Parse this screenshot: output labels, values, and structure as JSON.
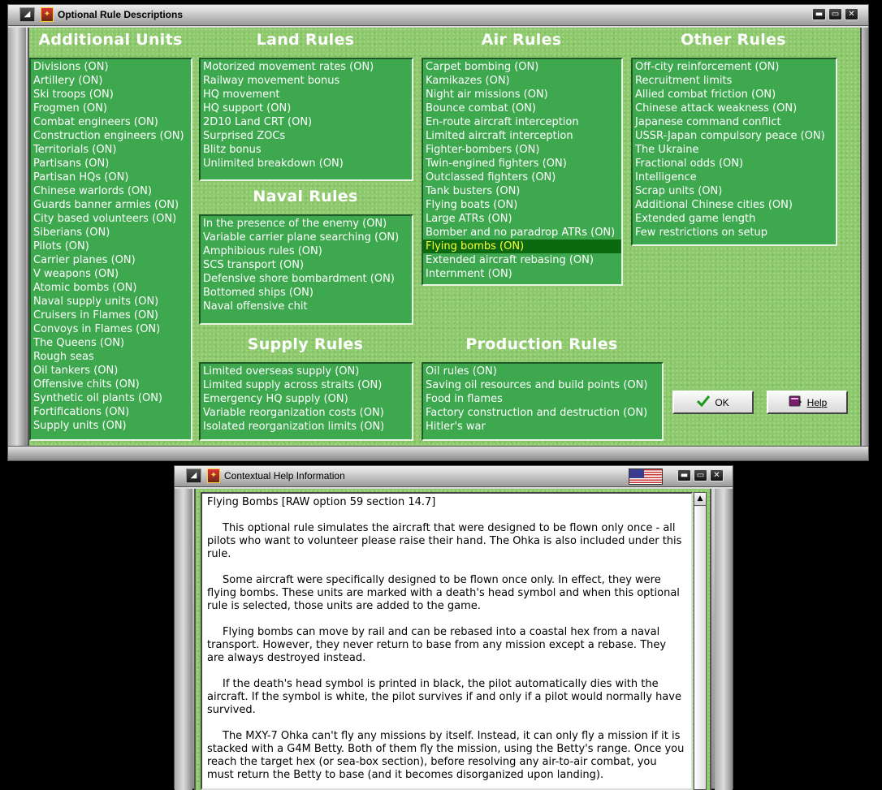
{
  "main_window": {
    "title": "Optional Rule Descriptions",
    "sections": {
      "additional_units": {
        "heading": "Additional Units",
        "items": [
          "Divisions (ON)",
          "Artillery (ON)",
          "Ski troops (ON)",
          "Frogmen (ON)",
          "Combat engineers (ON)",
          "Construction engineers (ON)",
          "Territorials (ON)",
          "Partisans (ON)",
          "Partisan HQs (ON)",
          "Chinese warlords (ON)",
          "Guards banner armies (ON)",
          "City based volunteers (ON)",
          "Siberians (ON)",
          "Pilots (ON)",
          "Carrier planes (ON)",
          "V weapons (ON)",
          "Atomic bombs (ON)",
          "Naval supply units (ON)",
          "Cruisers in Flames (ON)",
          "Convoys in Flames (ON)",
          "The Queens (ON)",
          "Rough seas",
          "Oil tankers (ON)",
          "Offensive chits (ON)",
          "Synthetic oil plants (ON)",
          "Fortifications (ON)",
          "Supply units (ON)"
        ]
      },
      "land_rules": {
        "heading": "Land Rules",
        "items": [
          "Motorized movement rates (ON)",
          "Railway movement bonus",
          "HQ movement",
          "HQ support (ON)",
          "2D10 Land CRT (ON)",
          "Surprised ZOCs",
          "Blitz bonus",
          "Unlimited breakdown (ON)"
        ]
      },
      "naval_rules": {
        "heading": "Naval Rules",
        "items": [
          "In the presence of the enemy (ON)",
          "Variable carrier plane searching (ON)",
          "Amphibious rules (ON)",
          "SCS transport (ON)",
          "Defensive shore bombardment (ON)",
          "Bottomed ships (ON)",
          "Naval offensive chit"
        ]
      },
      "air_rules": {
        "heading": "Air Rules",
        "selected_index": 13,
        "items": [
          "Carpet bombing (ON)",
          "Kamikazes (ON)",
          "Night air missions (ON)",
          "Bounce combat (ON)",
          "En-route aircraft interception",
          "Limited aircraft interception",
          "Fighter-bombers (ON)",
          "Twin-engined fighters (ON)",
          "Outclassed fighters (ON)",
          "Tank busters (ON)",
          "Flying boats (ON)",
          "Large ATRs (ON)",
          "Bomber and no paradrop ATRs (ON)",
          "Flying bombs (ON)",
          "Extended aircraft rebasing (ON)",
          "Internment (ON)"
        ]
      },
      "other_rules": {
        "heading": "Other Rules",
        "items": [
          "Off-city reinforcement (ON)",
          "Recruitment limits",
          "Allied combat friction (ON)",
          "Chinese attack weakness (ON)",
          "Japanese command conflict",
          "USSR-Japan compulsory peace (ON)",
          "The Ukraine",
          "Fractional odds (ON)",
          "Intelligence",
          "Scrap units (ON)",
          "Additional Chinese cities (ON)",
          "Extended game length",
          "Few restrictions on setup"
        ]
      },
      "supply_rules": {
        "heading": "Supply Rules",
        "items": [
          "Limited overseas supply (ON)",
          "Limited supply across straits (ON)",
          "Emergency HQ supply (ON)",
          "Variable reorganization costs (ON)",
          "Isolated reorganization limits (ON)"
        ]
      },
      "production_rules": {
        "heading": "Production Rules",
        "items": [
          "Oil rules (ON)",
          "Saving oil resources and build points (ON)",
          "Food in flames",
          "Factory construction and destruction (ON)",
          "Hitler's war"
        ]
      }
    },
    "buttons": {
      "ok": {
        "label": "OK",
        "icon": "checkmark-icon",
        "icon_color": "#1a9a1a"
      },
      "help": {
        "label": "Help",
        "icon": "book-icon",
        "icon_color": "#7a1a6a"
      }
    }
  },
  "help_window": {
    "title": "Contextual Help Information",
    "flag_icon": "us-flag-icon",
    "heading_line": "Flying Bombs [RAW option 59 section 14.7]",
    "paragraphs": [
      "This optional rule simulates the aircraft that were designed to be flown only once - all pilots who want to volunteer please raise their hand.  The Ohka is also included under this rule.",
      "Some aircraft were specifically designed to be flown once only.  In effect, they were flying bombs. These units are marked with a death's head symbol and when this optional rule is selected, those units are added to the game.",
      "Flying bombs can move by rail and can be rebased into a coastal hex from a naval transport.  However, they never return to base from any mission except a rebase.  They are always destroyed instead.",
      "If the death's head symbol is printed in black, the pilot automatically dies with the aircraft.  If the symbol is white, the pilot survives if and only if a pilot would normally have survived.",
      "The MXY-7 Ohka can't fly any missions by itself.  Instead, it can only fly a mission if it is stacked with a G4M Betty.  Both of them fly the mission, using the Betty's range.  Once you reach the target hex (or sea-box section), before resolving any air-to-air combat, you must return the Betty to base (and it becomes disorganized upon landing)."
    ]
  },
  "colors": {
    "panel_background": "#8ec86d",
    "list_background": "#3ea84f",
    "selected_background": "#0b6a10",
    "selected_text": "#ffff3a"
  }
}
